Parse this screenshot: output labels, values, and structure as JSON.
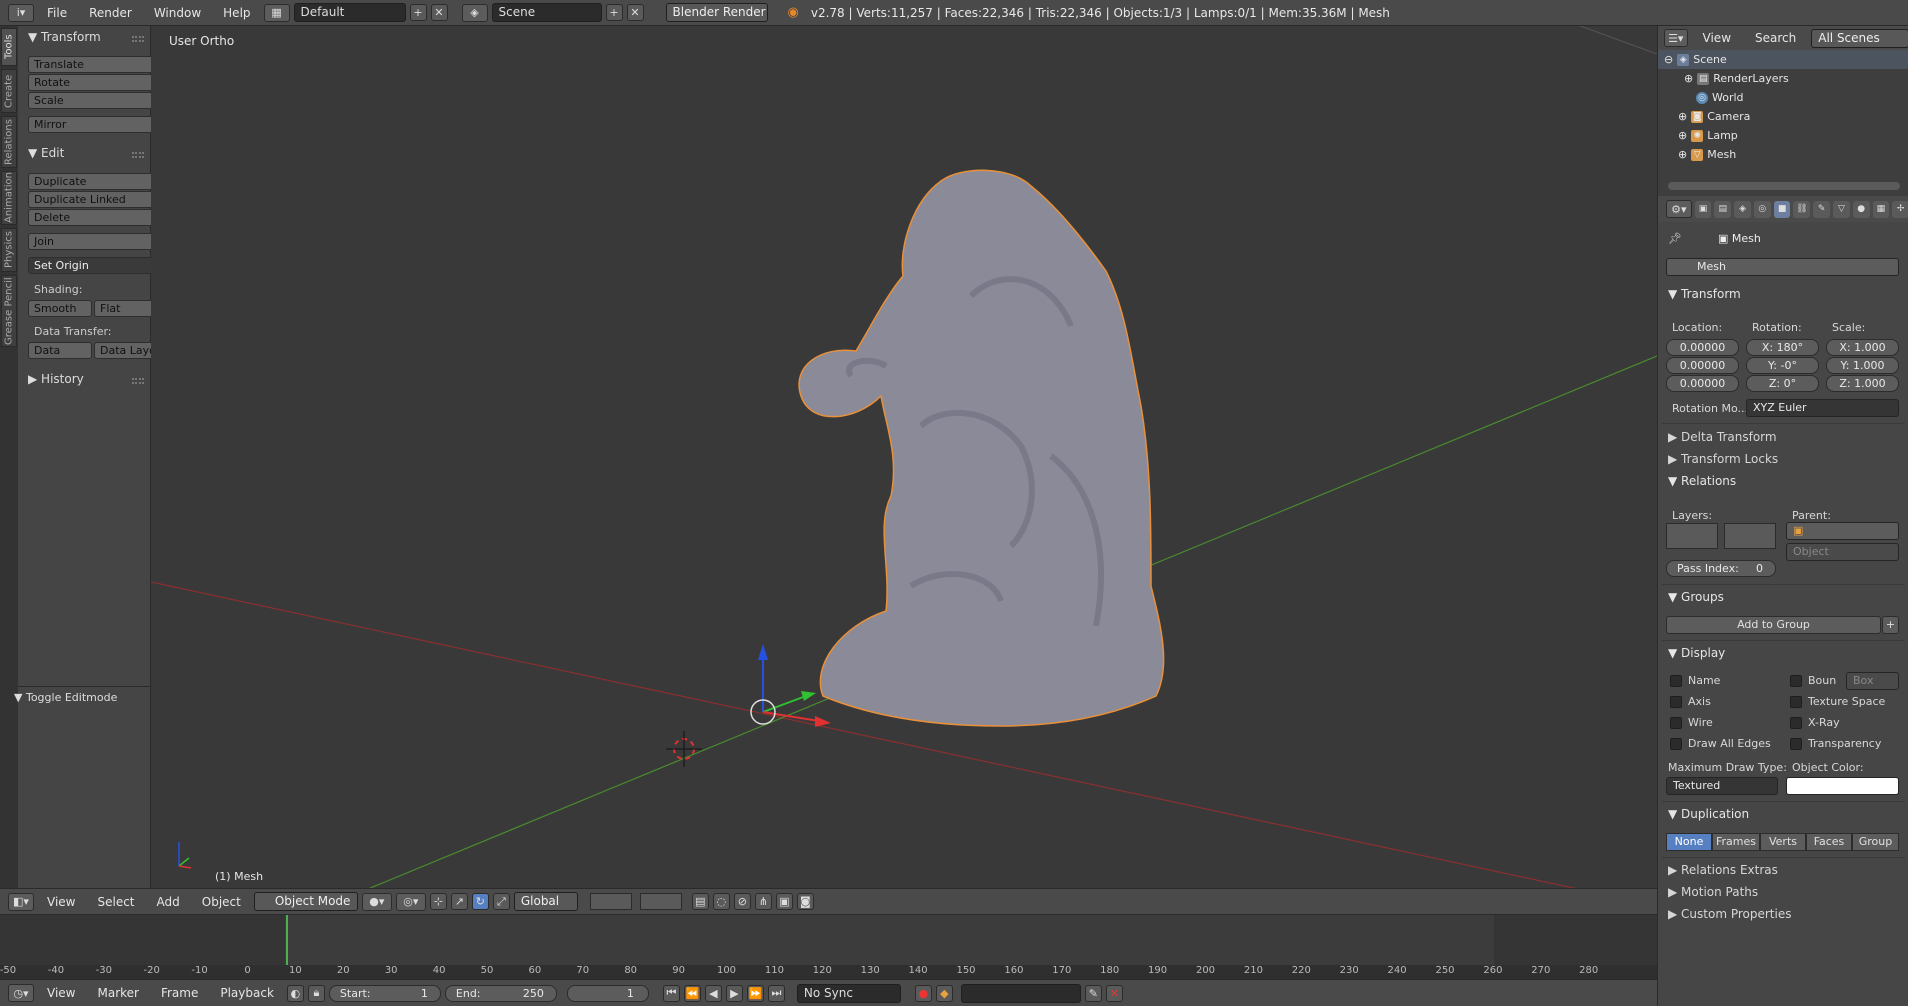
{
  "topbar": {
    "menus": [
      "File",
      "Render",
      "Window",
      "Help"
    ],
    "layout": "Default",
    "scene": "Scene",
    "engine": "Blender Render",
    "stats": "v2.78 | Verts:11,257 | Faces:22,346 | Tris:22,346 | Objects:1/3 | Lamps:0/1 | Mem:35.36M | Mesh"
  },
  "vtabs": [
    "Tools",
    "Create",
    "Relations",
    "Animation",
    "Physics",
    "Grease Pencil"
  ],
  "tools": {
    "transform_header": "Transform",
    "translate": "Translate",
    "rotate": "Rotate",
    "scale": "Scale",
    "mirror": "Mirror",
    "edit_header": "Edit",
    "duplicate": "Duplicate",
    "duplicate_linked": "Duplicate Linked",
    "delete": "Delete",
    "join": "Join",
    "set_origin": "Set Origin",
    "shading_label": "Shading:",
    "smooth": "Smooth",
    "flat": "Flat",
    "data_transfer_label": "Data Transfer:",
    "data": "Data",
    "data_layout": "Data Layo",
    "history_header": "History",
    "toggle_editmode": "Toggle Editmode"
  },
  "viewport": {
    "title": "User Ortho",
    "object_label": "(1) Mesh"
  },
  "v3d_header": {
    "menus": [
      "View",
      "Select",
      "Add",
      "Object"
    ],
    "mode": "Object Mode",
    "orientation": "Global"
  },
  "timeline": {
    "ticks": [
      "-50",
      "-40",
      "-30",
      "-20",
      "-10",
      "0",
      "10",
      "20",
      "30",
      "40",
      "50",
      "60",
      "70",
      "80",
      "90",
      "100",
      "110",
      "120",
      "130",
      "140",
      "150",
      "160",
      "170",
      "180",
      "190",
      "200",
      "210",
      "220",
      "230",
      "240",
      "250",
      "260",
      "270",
      "280"
    ],
    "menus": [
      "View",
      "Marker",
      "Frame",
      "Playback"
    ],
    "start": "Start:",
    "start_val": "1",
    "end": "End:",
    "end_val": "250",
    "current": "1",
    "sync": "No Sync"
  },
  "outliner": {
    "view": "View",
    "search": "Search",
    "filter": "All Scenes",
    "rows": [
      "Scene",
      "RenderLayers",
      "World",
      "Camera",
      "Lamp",
      "Mesh"
    ]
  },
  "properties": {
    "object_name_crumb": "Mesh",
    "object_name": "Mesh",
    "transform": "Transform",
    "location": "Location:",
    "rotation": "Rotation:",
    "scale": "Scale:",
    "loc": [
      "0.00000",
      "0.00000",
      "0.00000"
    ],
    "rot": [
      "X:",
      "180°",
      "Y:",
      "-0°",
      "Z:",
      "0°"
    ],
    "scl": [
      "X:",
      "1.000",
      "Y:",
      "1.000",
      "Z:",
      "1.000"
    ],
    "rotation_mode_label": "Rotation Mo...",
    "rotation_mode": "XYZ Euler",
    "delta_transform": "Delta Transform",
    "transform_locks": "Transform Locks",
    "relations": "Relations",
    "layers": "Layers:",
    "parent": "Parent:",
    "parent_type": "Object",
    "pass_index": "Pass Index:",
    "pass_index_val": "0",
    "groups": "Groups",
    "add_to_group": "Add to Group",
    "display": "Display",
    "name": "Name",
    "bounds": "Boun",
    "bounds_type": "Box",
    "axis": "Axis",
    "texture_space": "Texture Space",
    "wire": "Wire",
    "xray": "X-Ray",
    "draw_all_edges": "Draw All Edges",
    "transparency": "Transparency",
    "max_draw_type_label": "Maximum Draw Type:",
    "max_draw_type": "Textured",
    "object_color_label": "Object Color:",
    "duplication": "Duplication",
    "dup_opts": [
      "None",
      "Frames",
      "Verts",
      "Faces",
      "Group"
    ],
    "relations_extras": "Relations Extras",
    "motion_paths": "Motion Paths",
    "custom_properties": "Custom Properties"
  }
}
